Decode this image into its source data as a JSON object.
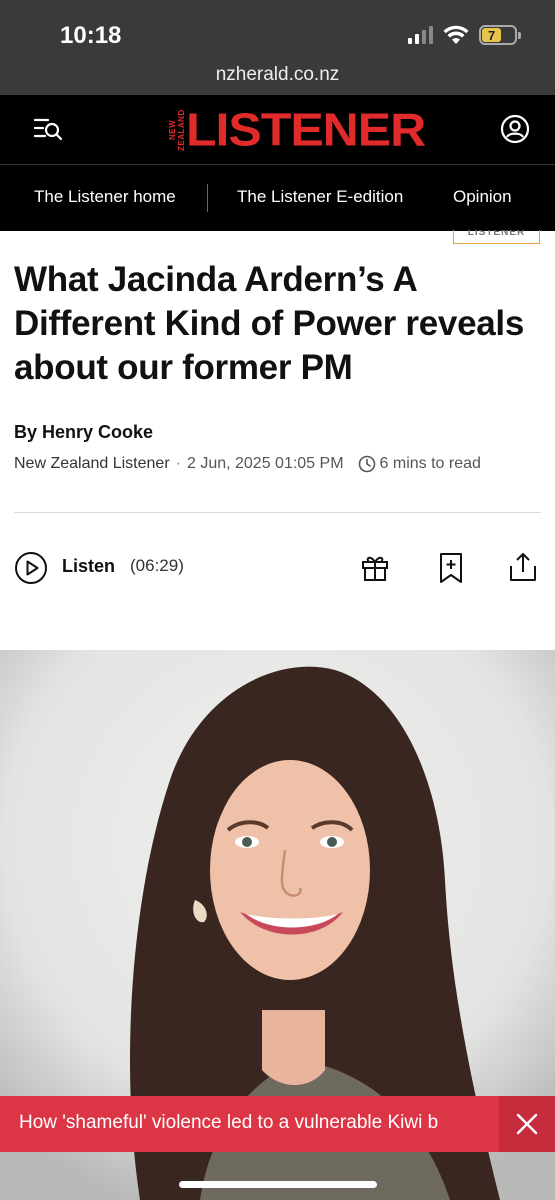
{
  "status_bar": {
    "time": "10:18",
    "battery_level": "7",
    "url": "nzherald.co.nz"
  },
  "header": {
    "logo_small": "NEW ZEALAND",
    "logo_main": "LISTENER",
    "menu_search_icon": "menu-search-icon",
    "account_icon": "account-icon"
  },
  "nav": {
    "items": [
      {
        "label": "The Listener home"
      },
      {
        "label": "The Listener E-edition"
      },
      {
        "label": "Opinion"
      }
    ]
  },
  "article": {
    "section_tag": "LISTENER",
    "headline": "What Jacinda Ardern’s A Different Kind of Power reveals about our former PM",
    "byline": "By Henry Cooke",
    "publication": "New Zealand Listener",
    "separator": "·",
    "date": "2 Jun, 2025 01:05 PM",
    "read_time": "6 mins to read"
  },
  "listen": {
    "label": "Listen",
    "duration": "(06:29)"
  },
  "banner": {
    "text": "How 'shameful' violence led to a vulnerable Kiwi b"
  },
  "colors": {
    "brand_red": "#e12a2a",
    "banner_red": "#dc3545",
    "tag_border": "#e9a23b"
  }
}
